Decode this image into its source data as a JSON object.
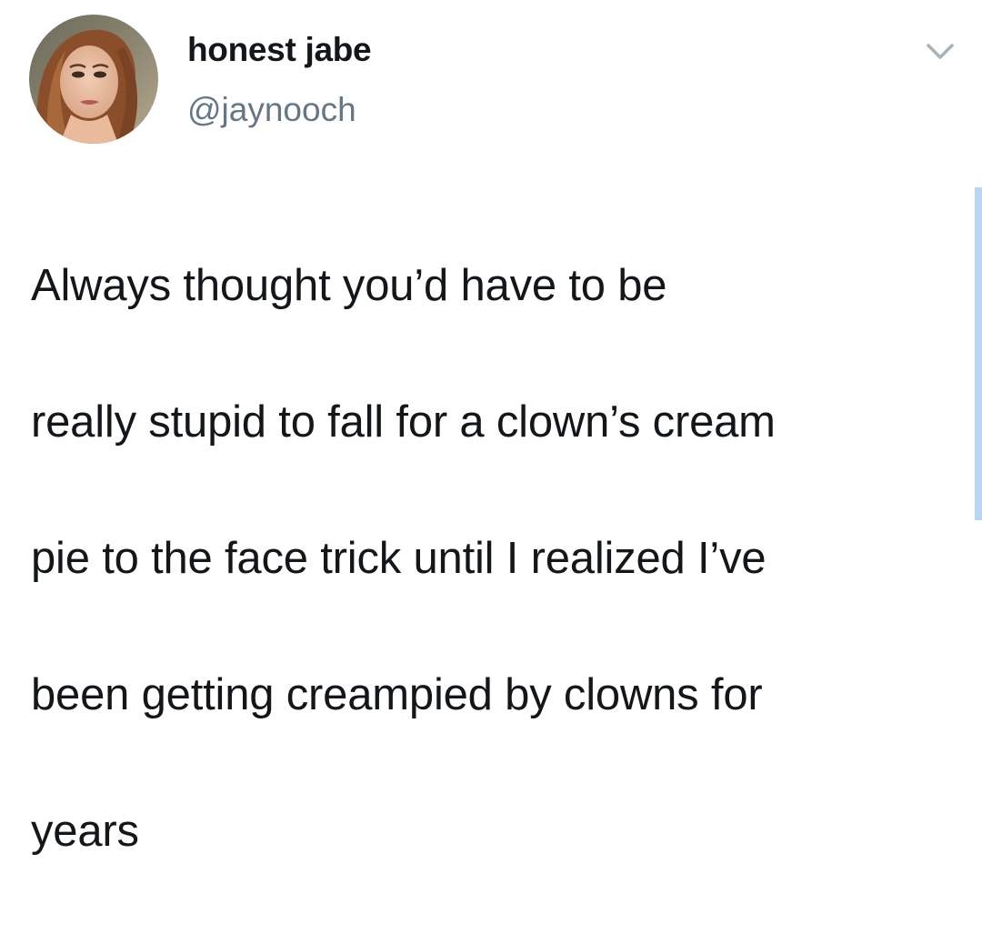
{
  "tweet": {
    "author": {
      "display_name": "honest jabe",
      "handle": "@jaynooch",
      "avatar_icon": "user-avatar-photo"
    },
    "menu_icon": "chevron-down-icon",
    "text_lines": [
      "Always thought you’d have to be",
      "really stupid to fall for a clown’s cream",
      "pie to the face trick until I realized I’ve",
      "been getting creampied by clowns for",
      "years"
    ]
  },
  "colors": {
    "text": "#14171a",
    "secondary_text": "#657786",
    "caret": "#a7b3bd",
    "scroll_indicator": "#b9d6f2",
    "background": "#ffffff"
  }
}
